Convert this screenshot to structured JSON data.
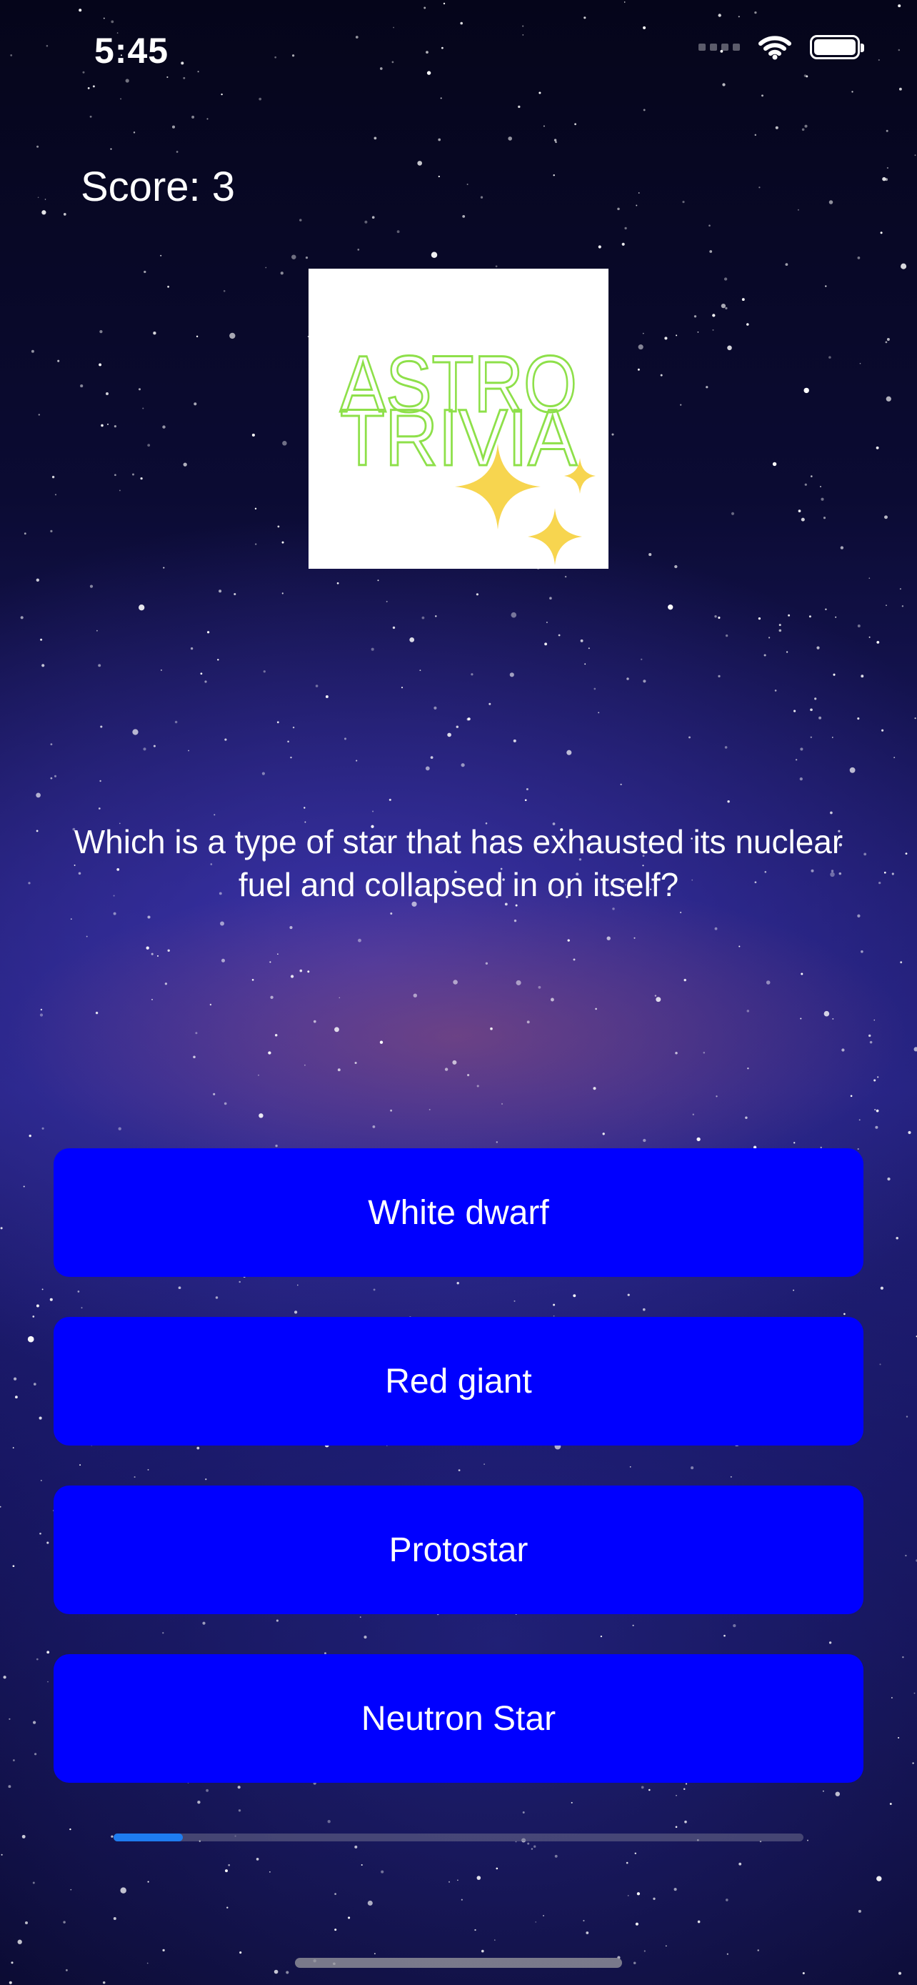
{
  "status_bar": {
    "time": "5:45",
    "icons": [
      "cellular-signal-icon",
      "wifi-icon",
      "battery-icon"
    ]
  },
  "score": {
    "text": "Score: 3"
  },
  "logo": {
    "line1": "ASTRO",
    "line2": "TRIVIA",
    "text_color": "#8ee04a",
    "sparkle_color": "#f7d54f"
  },
  "question": {
    "text": "Which is a type of star that has exhausted its nuclear fuel and collapsed in on itself?"
  },
  "answers": [
    {
      "label": "White dwarf"
    },
    {
      "label": "Red giant"
    },
    {
      "label": "Protostar"
    },
    {
      "label": "Neutron Star"
    }
  ],
  "progress": {
    "fraction": 0.1
  },
  "colors": {
    "button": "#0000ff",
    "progress_fill": "#1e7cf0",
    "text": "#ffffff"
  }
}
